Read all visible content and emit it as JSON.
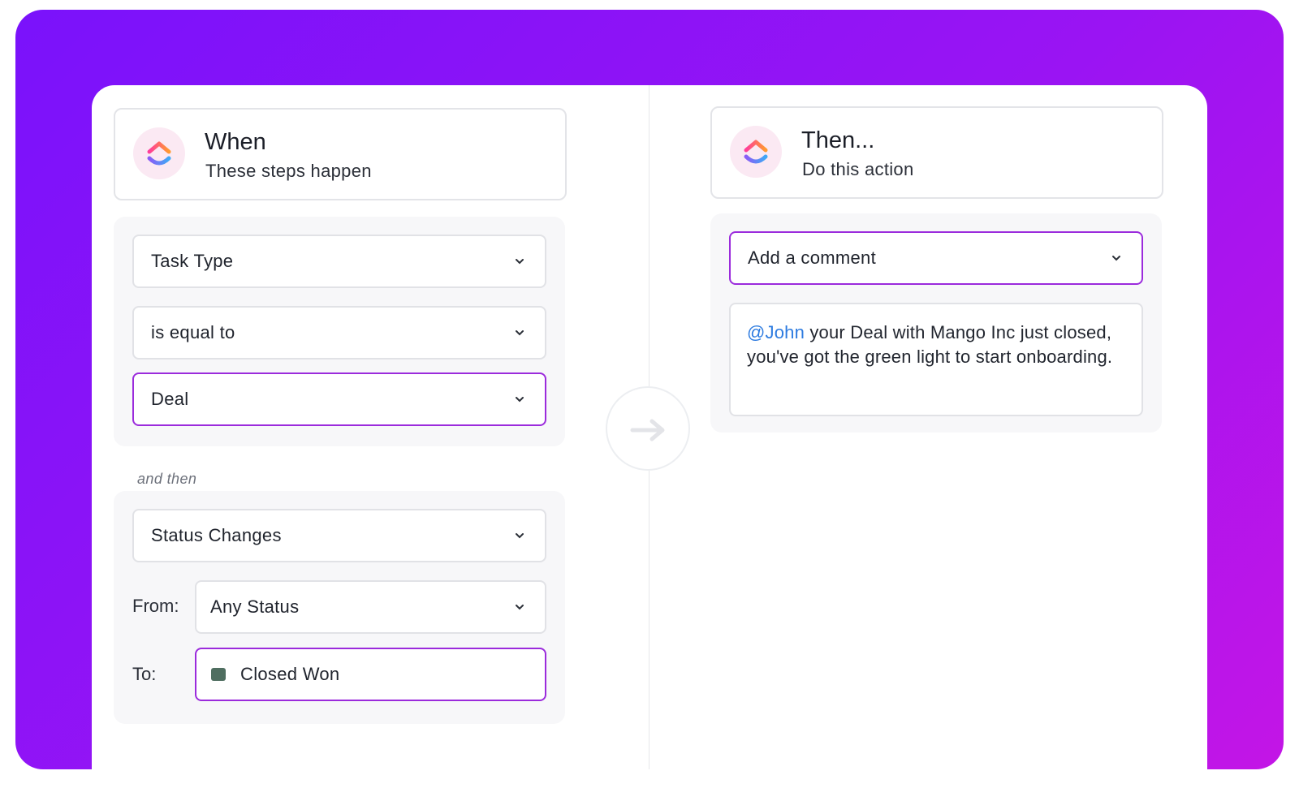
{
  "when": {
    "title": "When",
    "subtitle": "These steps happen",
    "selects": {
      "field": "Task Type",
      "operator": "is equal to",
      "value": "Deal"
    },
    "connector": "and then",
    "trigger": "Status Changes",
    "from_label": "From:",
    "from_value": "Any Status",
    "to_label": "To:",
    "to_value": "Closed Won",
    "to_color": "#4f6e60"
  },
  "then": {
    "title": "Then...",
    "subtitle": "Do this action",
    "action": "Add a comment",
    "comment": {
      "mention": "@John",
      "text": " your Deal with Mango Inc just closed, you've got the green light to start onboarding."
    }
  },
  "colors": {
    "accent": "#9b2bdc",
    "mention": "#2d7be0",
    "gradient_start": "#7a12fb",
    "gradient_end": "#c315e6"
  },
  "icons": {
    "logo": "clickup-logo-icon",
    "arrow": "arrow-right-icon",
    "chevron": "chevron-down-icon"
  }
}
